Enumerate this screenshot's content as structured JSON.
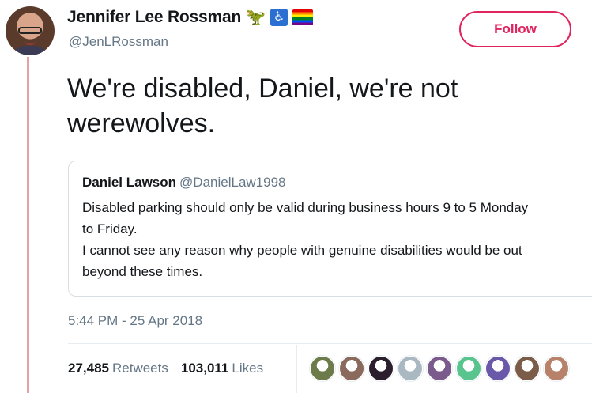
{
  "author": {
    "display_name": "Jennifer Lee Rossman",
    "handle": "@JenLRossman",
    "name_emojis": [
      "dinosaur",
      "wheelchair",
      "rainbow-flag"
    ]
  },
  "follow_button": {
    "label": "Follow",
    "color": "#e0245e"
  },
  "tweet": {
    "text": "We're disabled, Daniel, we're not werewolves.",
    "timestamp": "5:44 PM - 25 Apr 2018"
  },
  "quoted_tweet": {
    "name": "Daniel Lawson",
    "handle": "@DanielLaw1998",
    "lines": [
      "Disabled parking should only be valid during business hours 9 to 5 Monday",
      "to Friday.",
      "I cannot see any reason why people with genuine disabilities would be out",
      "beyond these times."
    ]
  },
  "stats": {
    "retweets_count": "27,485",
    "retweets_label": "Retweets",
    "likes_count": "103,011",
    "likes_label": "Likes"
  },
  "likers": [
    {
      "color": "#6d7b4a"
    },
    {
      "color": "#8a6a5c"
    },
    {
      "color": "#2b1f2e"
    },
    {
      "color": "#aab8c2"
    },
    {
      "color": "#7b5a8c"
    },
    {
      "color": "#59c48e"
    },
    {
      "color": "#6a58a8"
    },
    {
      "color": "#7a5c48"
    },
    {
      "color": "#b8826a"
    }
  ]
}
